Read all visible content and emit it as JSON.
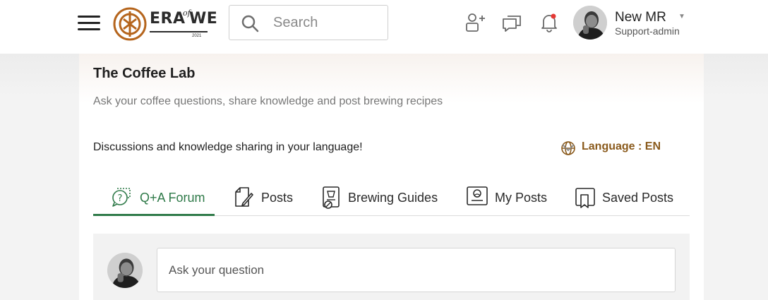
{
  "header": {
    "logo": {
      "word": "ERA",
      "of": "of",
      "we": "WE",
      "year": "2021"
    },
    "search": {
      "placeholder": "Search"
    },
    "user": {
      "name": "New MR",
      "role": "Support-admin"
    }
  },
  "community": {
    "title": "The Coffee Lab",
    "subtitle": "Ask your coffee questions, share knowledge and post brewing recipes",
    "discussion": "Discussions and knowledge sharing in your language!",
    "language_label": "Language : EN"
  },
  "tabs": [
    {
      "label": "Q+A Forum",
      "icon": "qa-forum-icon",
      "active": true
    },
    {
      "label": "Posts",
      "icon": "posts-icon",
      "active": false
    },
    {
      "label": "Brewing Guides",
      "icon": "brewing-guides-icon",
      "active": false
    },
    {
      "label": "My Posts",
      "icon": "my-posts-icon",
      "active": false
    },
    {
      "label": "Saved Posts",
      "icon": "saved-posts-icon",
      "active": false
    }
  ],
  "ask": {
    "placeholder": "Ask your question"
  },
  "colors": {
    "accent_green": "#2f7a49",
    "language_brown": "#8a5a1c",
    "logo_brown": "#b5651d",
    "notification_dot": "#e53935"
  }
}
